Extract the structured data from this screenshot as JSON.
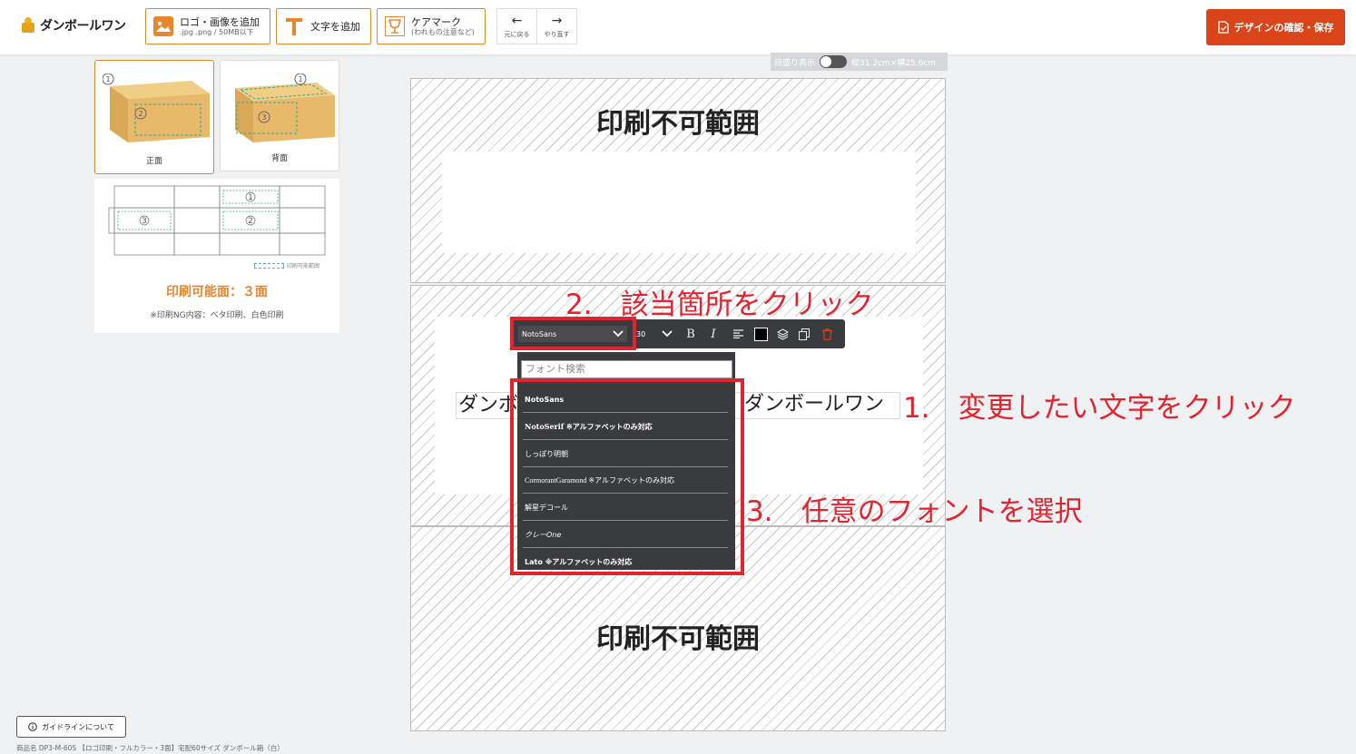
{
  "header": {
    "logo_text": "ダンボールワン",
    "add_logo_title": "ロゴ・画像を追加",
    "add_logo_sub": ".jpg .png / 50MB以下",
    "add_text_title": "文字を追加",
    "care_mark_title": "ケアマーク",
    "care_mark_sub": "(われもの注意など)",
    "undo_label": "元に戻る",
    "redo_label": "やり直す",
    "save_label": "デザインの確認・保存"
  },
  "sidebar": {
    "faces": [
      {
        "label": "正面",
        "active": true
      },
      {
        "label": "背面",
        "active": false
      }
    ],
    "diagram_legend": "印刷可能範囲",
    "print_title": "印刷可能面：３面",
    "print_note": "※印刷NG内容：ベタ印刷、白色印刷",
    "guide_button": "ガイドラインについて",
    "product_name": "商品名 DP3-M-60S 【ロゴ印刷・フルカラー・3面】宅配60サイズ ダンボール箱（白）"
  },
  "canvas": {
    "ruler_label": "目盛り表示",
    "dimensions": "縦31.2cm×横25.6cm",
    "no_print_top": "印刷不可範囲",
    "no_print_bottom": "印刷不可範囲",
    "text_object_left": "ダンボ",
    "text_object_right": "ダンボールワン"
  },
  "text_toolbar": {
    "font_value": "NotoSans",
    "size_value": "30"
  },
  "font_dropdown": {
    "search_placeholder": "フォント検索",
    "fonts": [
      "NotoSans",
      "NotoSerif ※アルファベットのみ対応",
      "しっぽり明朝",
      "CormorantGaramond ※アルファベットのみ対応",
      "解星デコール",
      "クレーOne",
      "Lato ※アルファベットのみ対応"
    ]
  },
  "annotations": {
    "step1": "1.　変更したい文字をクリック",
    "step2": "2.　該当箇所をクリック",
    "step3": "3.　任意のフォントを選択"
  },
  "colors": {
    "accent_orange": "#e0892a",
    "save_red": "#d9441a",
    "annotation_red": "#e02430",
    "toolbar_dark": "#3a3b3f"
  }
}
